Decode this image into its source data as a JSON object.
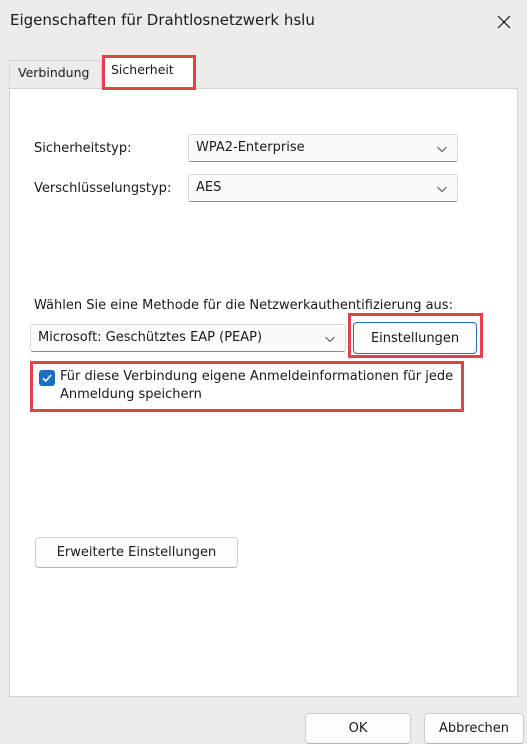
{
  "window": {
    "title": "Eigenschaften für Drahtlosnetzwerk hslu"
  },
  "tabs": [
    {
      "label": "Verbindung"
    },
    {
      "label": "Sicherheit"
    }
  ],
  "security": {
    "type_label": "Sicherheitstyp:",
    "type_value": "WPA2-Enterprise",
    "encryption_label": "Verschlüsselungstyp:",
    "encryption_value": "AES",
    "auth_method_prompt": "Wählen Sie eine Methode für die Netzwerkauthentifizierung aus:",
    "auth_method_value": "Microsoft: Geschütztes EAP (PEAP)",
    "settings_button": "Einstellungen",
    "remember_credentials_label": "Für diese Verbindung eigene Anmeldeinformationen für jede Anmeldung speichern",
    "remember_credentials_checked": true,
    "advanced_settings_button": "Erweiterte Einstellungen"
  },
  "footer": {
    "ok_label": "OK",
    "cancel_label": "Abbrechen"
  },
  "colors": {
    "highlight": "#e0434c",
    "checkbox_accent": "#1a6fc2"
  },
  "icons": {
    "close": "close-icon",
    "chevron": "chevron-down-icon",
    "check": "checkmark-icon"
  }
}
